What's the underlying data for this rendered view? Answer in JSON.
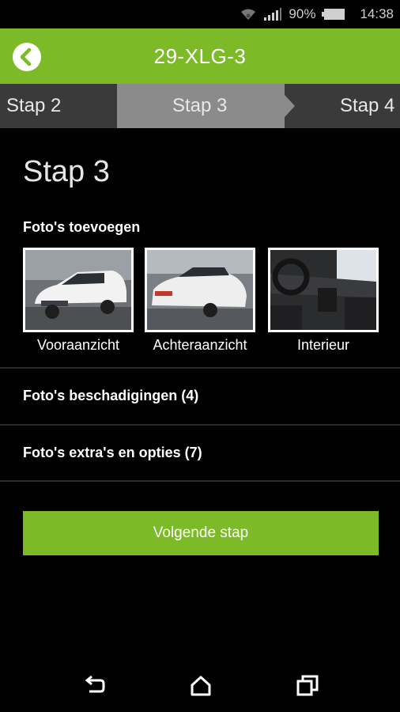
{
  "status": {
    "battery": "90%",
    "time": "14:38"
  },
  "appbar": {
    "title": "29-XLG-3"
  },
  "steps": {
    "prev": "Stap 2",
    "current": "Stap 3",
    "next": "Stap 4"
  },
  "page": {
    "heading": "Stap 3"
  },
  "photos": {
    "title": "Foto's toevoegen",
    "items": [
      {
        "label": "Vooraanzicht"
      },
      {
        "label": "Achteraanzicht"
      },
      {
        "label": "Interieur"
      }
    ]
  },
  "sections": {
    "damages": "Foto's beschadigingen (4)",
    "extras": "Foto's extra's en opties (7)"
  },
  "actions": {
    "next": "Volgende stap"
  },
  "colors": {
    "accent": "#7cbb27",
    "stepbar": "#3a3a3a",
    "step_active": "#8b8b8b"
  },
  "icons": [
    "wifi-icon",
    "signal-icon",
    "battery-icon",
    "back-icon",
    "back-nav-icon",
    "home-nav-icon",
    "recents-nav-icon"
  ]
}
